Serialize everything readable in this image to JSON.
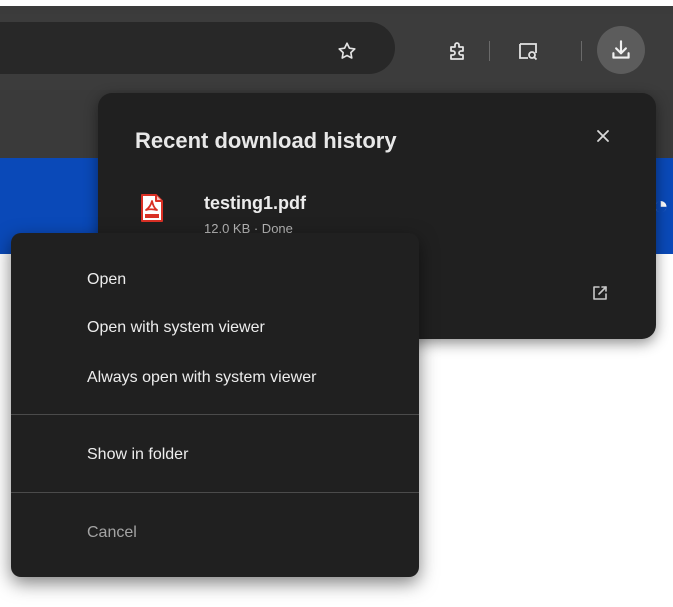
{
  "toolbar": {
    "icons": [
      "star-icon",
      "extension-icon",
      "tab-search-icon",
      "download-icon"
    ]
  },
  "download_panel": {
    "title": "Recent download history",
    "close_icon": "close-icon",
    "file": {
      "name": "testing1.pdf",
      "meta": "12.0 KB · Done",
      "icon": "pdf-icon"
    },
    "open_icon": "open-external-icon"
  },
  "context_menu": {
    "items": [
      {
        "label": "Open"
      },
      {
        "label": "Open with system viewer"
      },
      {
        "label": "Always open with system viewer"
      },
      {
        "label": "Show in folder"
      },
      {
        "label": "Cancel",
        "disabled": true
      }
    ]
  },
  "colors": {
    "toolbar": "#3c3c3c",
    "panel": "#202020",
    "page_header": "#0a49b8",
    "pdf_red": "#d93025"
  }
}
